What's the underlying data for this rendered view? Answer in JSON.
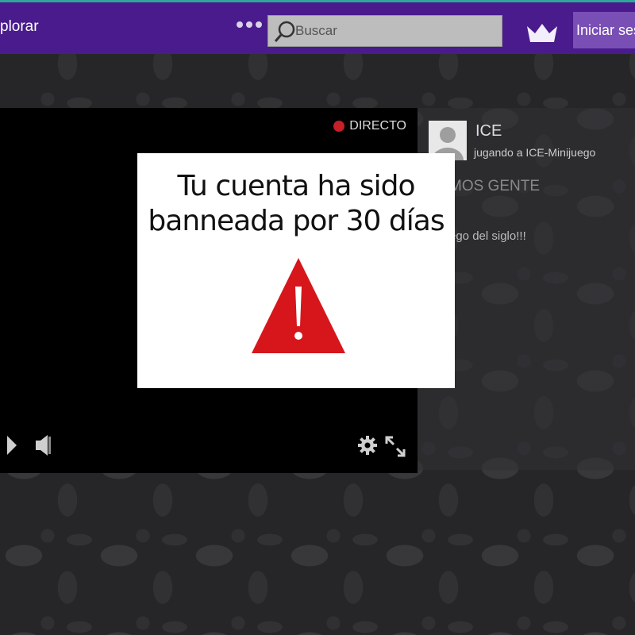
{
  "header": {
    "explore_label": "plorar",
    "search": {
      "placeholder": "Buscar",
      "value": ""
    },
    "login_label": "Iniciar ses"
  },
  "player": {
    "live_label": "DIRECTO"
  },
  "stream_info": {
    "streamer": "ICE",
    "playing": "jugando a ICE-Minijuego",
    "title_fragment": "MOS GENTE",
    "description_fragment": "ego del siglo!!!"
  },
  "modal": {
    "message_line1": "Tu cuenta ha sido",
    "message_line2": "banneada por 30 días"
  },
  "colors": {
    "header_bg": "#4a1b8c",
    "header_top_accent": "#2fa79a",
    "live_dot": "#c61f28",
    "warning_triangle": "#d7161b",
    "login_button": "#7a4fb5"
  },
  "icons": [
    "more-dots-icon",
    "search-icon",
    "crown-icon",
    "play-icon",
    "volume-icon",
    "gear-icon",
    "expand-icon",
    "warning-icon",
    "avatar-placeholder-icon",
    "live-dot-icon"
  ]
}
